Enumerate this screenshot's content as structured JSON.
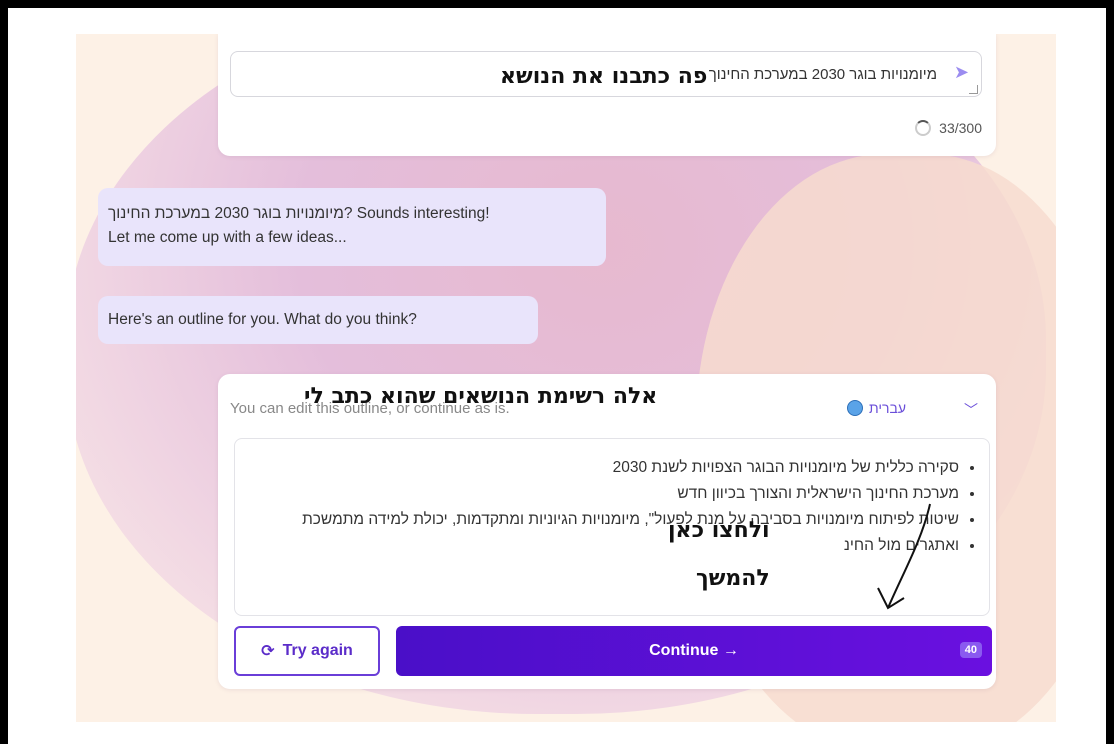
{
  "input": {
    "value": "מיומנויות בוגר 2030 במערכת החינוך",
    "counter": "33/300",
    "send_icon": "send-arrow-icon"
  },
  "bubbles": {
    "first_line1": "מיומנויות בוגר 2030 במערכת החינוך? Sounds interesting!",
    "first_line2": "Let me come up with a few ideas...",
    "second": "Here's an outline for you. What do you think?"
  },
  "outline": {
    "hint": "You can edit this outline, or continue as is.",
    "language": "עברית",
    "items": [
      "סקירה כללית של מיומנויות הבוגר הצפויות לשנת 2030",
      "מערכת החינוך הישראלית והצורך בכיוון חדש",
      "שיטות לפיתוח מיומנויות בסביבה על מנת לפעול\", מיומנויות הגיוניות ומתקדמות, יכולת למידה מתמשכת",
      "ואתגרים מול החינ"
    ]
  },
  "buttons": {
    "try_again": "Try again",
    "continue": "Continue →",
    "credits": "40"
  },
  "annotations": {
    "topic": "פה כתבנו את הנושא",
    "list": "אלה רשימת הנושאים שהוא כתב לי",
    "click_line1": "ולחצו כאן",
    "click_line2": "להמשך"
  }
}
